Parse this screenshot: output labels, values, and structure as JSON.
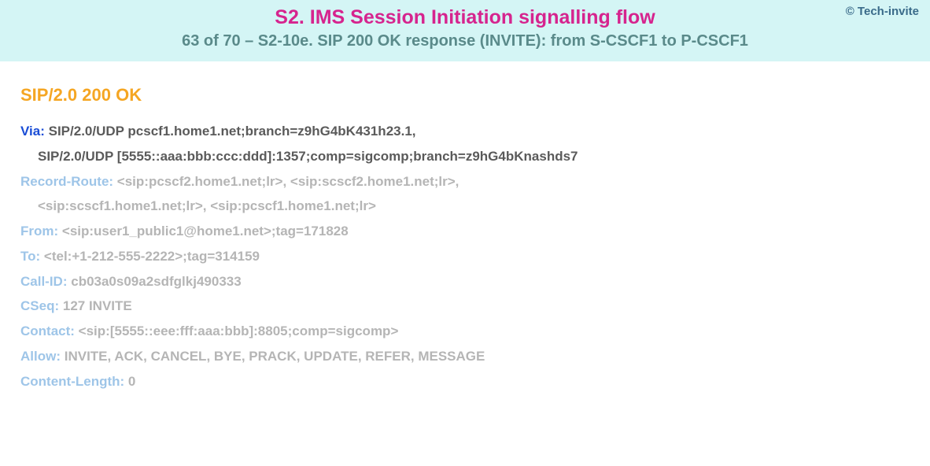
{
  "copyright": "© Tech-invite",
  "title_main": "S2. IMS Session Initiation signalling flow",
  "title_sub": "63 of 70 – S2-10e. SIP 200 OK response (INVITE): from S-CSCF1 to P-CSCF1",
  "status_line": "SIP/2.0 200 OK",
  "via": {
    "name": "Via",
    "line1": "SIP/2.0/UDP pcscf1.home1.net;branch=z9hG4bK431h23.1,",
    "line2": "SIP/2.0/UDP [5555::aaa:bbb:ccc:ddd]:1357;comp=sigcomp;branch=z9hG4bKnashds7"
  },
  "record_route": {
    "name": "Record-Route",
    "line1": "<sip:pcscf2.home1.net;lr>, <sip:scscf2.home1.net;lr>,",
    "line2": "<sip:scscf1.home1.net;lr>, <sip:pcscf1.home1.net;lr>"
  },
  "from": {
    "name": "From",
    "value": "<sip:user1_public1@home1.net>;tag=171828"
  },
  "to": {
    "name": "To",
    "value": "<tel:+1-212-555-2222>;tag=314159"
  },
  "call_id": {
    "name": "Call-ID",
    "value": "cb03a0s09a2sdfglkj490333"
  },
  "cseq": {
    "name": "CSeq",
    "value": "127 INVITE"
  },
  "contact": {
    "name": "Contact",
    "value": "<sip:[5555::eee:fff:aaa:bbb]:8805;comp=sigcomp>"
  },
  "allow": {
    "name": "Allow",
    "value": "INVITE, ACK, CANCEL, BYE, PRACK, UPDATE, REFER, MESSAGE"
  },
  "content_length": {
    "name": "Content-Length",
    "value": "0"
  }
}
